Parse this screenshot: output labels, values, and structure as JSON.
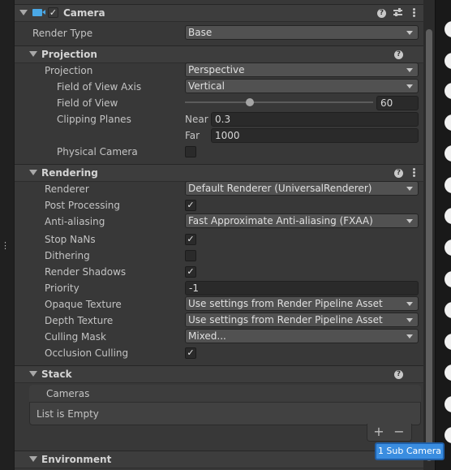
{
  "camera": {
    "title": "Camera",
    "enabled_check": "✓",
    "render_type": {
      "label": "Render Type",
      "value": "Base"
    }
  },
  "projection_section": {
    "title": "Projection",
    "projection": {
      "label": "Projection",
      "value": "Perspective"
    },
    "fov_axis": {
      "label": "Field of View Axis",
      "value": "Vertical"
    },
    "fov": {
      "label": "Field of View",
      "value": "60",
      "slider_fraction": 0.33
    },
    "clipping": {
      "label": "Clipping Planes",
      "near_label": "Near",
      "near_value": "0.3",
      "far_label": "Far",
      "far_value": "1000"
    },
    "physical_camera": {
      "label": "Physical Camera",
      "checked": false
    }
  },
  "rendering_section": {
    "title": "Rendering",
    "renderer": {
      "label": "Renderer",
      "value": "Default Renderer (UniversalRenderer)"
    },
    "post_processing": {
      "label": "Post Processing",
      "checked": true
    },
    "anti_aliasing": {
      "label": "Anti-aliasing",
      "value": "Fast Approximate Anti-aliasing (FXAA)"
    },
    "stop_nans": {
      "label": "Stop NaNs",
      "checked": true
    },
    "dithering": {
      "label": "Dithering",
      "checked": false
    },
    "render_shadows": {
      "label": "Render Shadows",
      "checked": true
    },
    "priority": {
      "label": "Priority",
      "value": "-1"
    },
    "opaque_texture": {
      "label": "Opaque Texture",
      "value": "Use settings from Render Pipeline Asset"
    },
    "depth_texture": {
      "label": "Depth Texture",
      "value": "Use settings from Render Pipeline Asset"
    },
    "culling_mask": {
      "label": "Culling Mask",
      "value": "Mixed..."
    },
    "occlusion_culling": {
      "label": "Occlusion Culling",
      "checked": true
    }
  },
  "stack_section": {
    "title": "Stack",
    "list_header": "Cameras",
    "empty_text": "List is Empty",
    "add_label": "+",
    "remove_label": "−"
  },
  "environment_section": {
    "title": "Environment"
  },
  "overlay": {
    "sub_camera_button": "1 Sub Camera"
  },
  "check_glyph": "✓",
  "icons": {
    "camera": "camera-icon",
    "help": "help-icon",
    "presets": "sliders-icon",
    "menu": "kebab-menu-icon",
    "foldout": "foldout-arrow-icon",
    "dropdown": "dropdown-arrow-icon"
  },
  "colors": {
    "inspector_bg": "#383838",
    "accent_blue": "#3a8de0",
    "camera_icon": "#4aa8e6"
  }
}
